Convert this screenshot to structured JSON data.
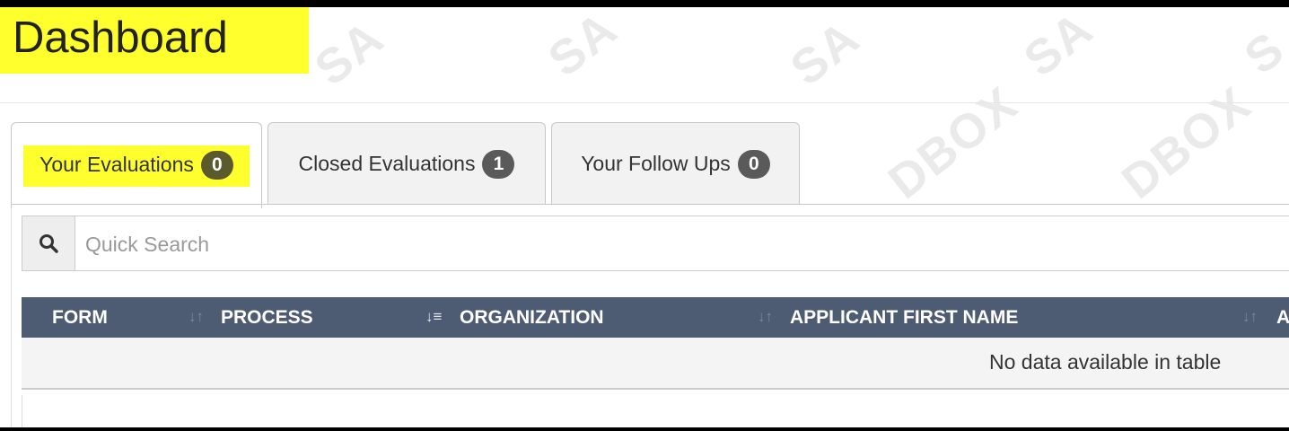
{
  "page": {
    "title": "Dashboard"
  },
  "watermark": {
    "text": "SANDBOX"
  },
  "tabs": [
    {
      "label": "Your Evaluations",
      "count": "0",
      "active": true
    },
    {
      "label": "Closed Evaluations",
      "count": "1",
      "active": false
    },
    {
      "label": "Your Follow Ups",
      "count": "0",
      "active": false
    }
  ],
  "search": {
    "placeholder": "Quick Search",
    "value": "",
    "icon": "search-icon"
  },
  "table": {
    "columns": [
      {
        "label": "FORM"
      },
      {
        "label": "PROCESS"
      },
      {
        "label": "ORGANIZATION"
      },
      {
        "label": "APPLICANT FIRST NAME"
      },
      {
        "label": "A"
      }
    ],
    "empty_message": "No data available in table"
  },
  "colors": {
    "highlight": "#ffff2e",
    "table_header": "#4d5b73",
    "badge": "#5a5a5a"
  }
}
